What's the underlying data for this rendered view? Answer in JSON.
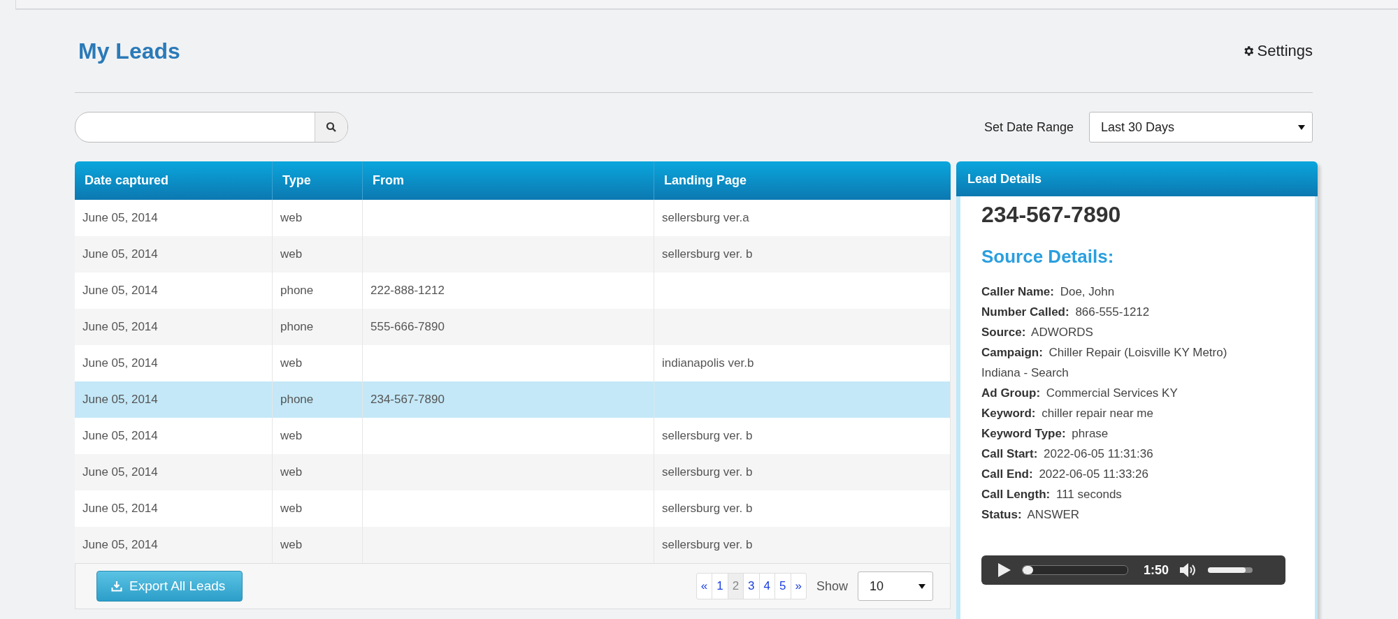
{
  "page": {
    "title": "My Leads",
    "settings_label": "Settings"
  },
  "date_range": {
    "label": "Set Date Range",
    "value": "Last 30 Days"
  },
  "table": {
    "columns": [
      "Date captured",
      "Type",
      "From",
      "Landing Page"
    ],
    "rows": [
      {
        "date": "June 05, 2014",
        "type": "web",
        "from": "",
        "landing_page": "sellersburg ver.a",
        "selected": false
      },
      {
        "date": "June 05, 2014",
        "type": "web",
        "from": "",
        "landing_page": "sellersburg ver. b",
        "selected": false
      },
      {
        "date": "June 05, 2014",
        "type": "phone",
        "from": "222-888-1212",
        "landing_page": "",
        "selected": false
      },
      {
        "date": "June 05, 2014",
        "type": "phone",
        "from": "555-666-7890",
        "landing_page": "",
        "selected": false
      },
      {
        "date": "June 05, 2014",
        "type": "web",
        "from": "",
        "landing_page": "indianapolis ver.b",
        "selected": false
      },
      {
        "date": "June 05, 2014",
        "type": "phone",
        "from": "234-567-7890",
        "landing_page": "",
        "selected": true
      },
      {
        "date": "June 05, 2014",
        "type": "web",
        "from": "",
        "landing_page": "sellersburg ver. b",
        "selected": false
      },
      {
        "date": "June 05, 2014",
        "type": "web",
        "from": "",
        "landing_page": "sellersburg ver. b",
        "selected": false
      },
      {
        "date": "June 05, 2014",
        "type": "web",
        "from": "",
        "landing_page": "sellersburg ver. b",
        "selected": false
      },
      {
        "date": "June 05, 2014",
        "type": "web",
        "from": "",
        "landing_page": "sellersburg ver. b",
        "selected": false
      }
    ]
  },
  "footer": {
    "export_label": "Export All Leads",
    "pagination": [
      {
        "label": "«",
        "selected": false
      },
      {
        "label": "1",
        "selected": false
      },
      {
        "label": "2",
        "selected": true
      },
      {
        "label": "3",
        "selected": false
      },
      {
        "label": "4",
        "selected": false
      },
      {
        "label": "5",
        "selected": false
      },
      {
        "label": "»",
        "selected": false
      }
    ],
    "show_label": "Show",
    "show_value": "10"
  },
  "lead_details": {
    "title": "Lead Details",
    "phone": "234-567-7890",
    "section_title": "Source Details:",
    "fields": [
      {
        "label": "Caller Name:",
        "value": "Doe, John"
      },
      {
        "label": "Number Called:",
        "value": "866-555-1212"
      },
      {
        "label": "Source:",
        "value": "ADWORDS"
      },
      {
        "label": "Campaign:",
        "value": "Chiller Repair (Loisville KY Metro)",
        "continuation": "Indiana - Search"
      },
      {
        "label": "Ad Group:",
        "value": "Commercial Services KY"
      },
      {
        "label": "Keyword:",
        "value": "chiller repair near me"
      },
      {
        "label": "Keyword Type:",
        "value": "phrase"
      },
      {
        "label": "Call Start:",
        "value": "2022-06-05 11:31:36"
      },
      {
        "label": "Call End:",
        "value": "2022-06-05 11:33:26"
      },
      {
        "label": "Call Length:",
        "value": "111 seconds"
      },
      {
        "label": "Status:",
        "value": "ANSWER"
      }
    ],
    "player": {
      "time": "1:50",
      "progress": {
        "level": 0.1
      },
      "volume": {
        "level": 0.85
      }
    }
  }
}
